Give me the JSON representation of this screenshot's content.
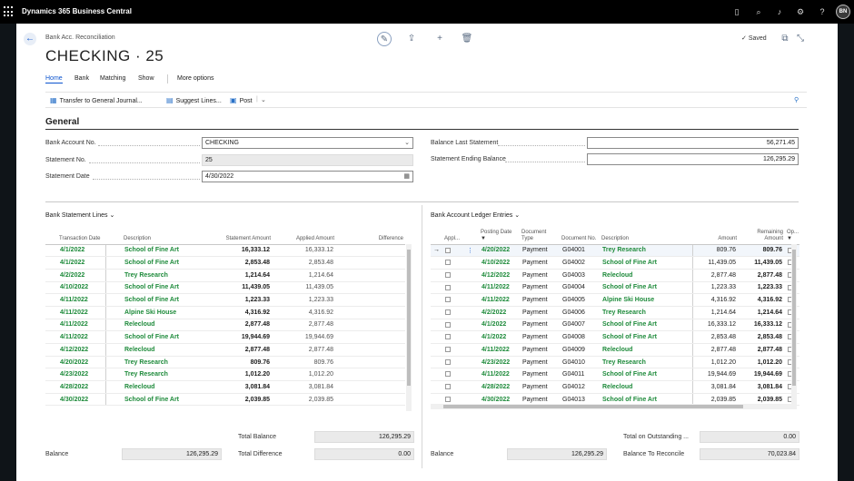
{
  "app": {
    "title": "Dynamics 365 Business Central",
    "avatar": "BN"
  },
  "header": {
    "breadcrumb": "Bank Acc. Reconciliation",
    "title": "CHECKING · 25",
    "saved": "Saved"
  },
  "menu": {
    "home": "Home",
    "bank": "Bank",
    "matching": "Matching",
    "show": "Show",
    "more": "More options"
  },
  "actions": {
    "transfer": "Transfer to General Journal...",
    "suggest": "Suggest Lines...",
    "post": "Post"
  },
  "general": {
    "title": "General",
    "bank_account_no_label": "Bank Account No.",
    "bank_account_no": "CHECKING",
    "statement_no_label": "Statement No.",
    "statement_no": "25",
    "statement_date_label": "Statement Date",
    "statement_date": "4/30/2022",
    "balance_last_label": "Balance Last Statement",
    "balance_last": "56,271.45",
    "ending_balance_label": "Statement Ending Balance",
    "ending_balance": "126,295.29"
  },
  "statement_lines": {
    "title": "Bank Statement Lines",
    "columns": [
      "Transaction Date",
      "Description",
      "Statement Amount",
      "Applied Amount",
      "Difference"
    ],
    "rows": [
      [
        "4/1/2022",
        "School of Fine Art",
        "16,333.12",
        "16,333.12",
        ""
      ],
      [
        "4/1/2022",
        "School of Fine Art",
        "2,853.48",
        "2,853.48",
        ""
      ],
      [
        "4/2/2022",
        "Trey Research",
        "1,214.64",
        "1,214.64",
        ""
      ],
      [
        "4/10/2022",
        "School of Fine Art",
        "11,439.05",
        "11,439.05",
        ""
      ],
      [
        "4/11/2022",
        "School of Fine Art",
        "1,223.33",
        "1,223.33",
        ""
      ],
      [
        "4/11/2022",
        "Alpine Ski House",
        "4,316.92",
        "4,316.92",
        ""
      ],
      [
        "4/11/2022",
        "Relecloud",
        "2,877.48",
        "2,877.48",
        ""
      ],
      [
        "4/11/2022",
        "School of Fine Art",
        "19,944.69",
        "19,944.69",
        ""
      ],
      [
        "4/12/2022",
        "Relecloud",
        "2,877.48",
        "2,877.48",
        ""
      ],
      [
        "4/20/2022",
        "Trey Research",
        "809.76",
        "809.76",
        ""
      ],
      [
        "4/23/2022",
        "Trey Research",
        "1,012.20",
        "1,012.20",
        ""
      ],
      [
        "4/28/2022",
        "Relecloud",
        "3,081.84",
        "3,081.84",
        ""
      ],
      [
        "4/30/2022",
        "School of Fine Art",
        "2,039.85",
        "2,039.85",
        ""
      ]
    ],
    "total_balance_label": "Total Balance",
    "total_balance": "126,295.29",
    "total_difference_label": "Total Difference",
    "total_difference": "0.00",
    "balance_label": "Balance",
    "balance": "126,295.29"
  },
  "ledger_entries": {
    "title": "Bank Account Ledger Entries",
    "columns": [
      "Appl...",
      "Posting Date",
      "Document Type",
      "Document No.",
      "Description",
      "Amount",
      "Remaining Amount",
      "Op..."
    ],
    "rows": [
      [
        "4/20/2022",
        "Payment",
        "G04001",
        "Trey Research",
        "809.76",
        "809.76"
      ],
      [
        "4/10/2022",
        "Payment",
        "G04002",
        "School of Fine Art",
        "11,439.05",
        "11,439.05"
      ],
      [
        "4/12/2022",
        "Payment",
        "G04003",
        "Relecloud",
        "2,877.48",
        "2,877.48"
      ],
      [
        "4/11/2022",
        "Payment",
        "G04004",
        "School of Fine Art",
        "1,223.33",
        "1,223.33"
      ],
      [
        "4/11/2022",
        "Payment",
        "G04005",
        "Alpine Ski House",
        "4,316.92",
        "4,316.92"
      ],
      [
        "4/2/2022",
        "Payment",
        "G04006",
        "Trey Research",
        "1,214.64",
        "1,214.64"
      ],
      [
        "4/1/2022",
        "Payment",
        "G04007",
        "School of Fine Art",
        "16,333.12",
        "16,333.12"
      ],
      [
        "4/1/2022",
        "Payment",
        "G04008",
        "School of Fine Art",
        "2,853.48",
        "2,853.48"
      ],
      [
        "4/11/2022",
        "Payment",
        "G04009",
        "Relecloud",
        "2,877.48",
        "2,877.48"
      ],
      [
        "4/23/2022",
        "Payment",
        "G04010",
        "Trey Research",
        "1,012.20",
        "1,012.20"
      ],
      [
        "4/11/2022",
        "Payment",
        "G04011",
        "School of Fine Art",
        "19,944.69",
        "19,944.69"
      ],
      [
        "4/28/2022",
        "Payment",
        "G04012",
        "Relecloud",
        "3,081.84",
        "3,081.84"
      ],
      [
        "4/30/2022",
        "Payment",
        "G04013",
        "School of Fine Art",
        "2,039.85",
        "2,039.85"
      ]
    ],
    "outstanding_label": "Total on Outstanding ...",
    "outstanding": "0.00",
    "balance_label": "Balance",
    "balance": "126,295.29",
    "to_reconcile_label": "Balance To Reconcile",
    "to_reconcile": "70,023.84"
  },
  "colors": {
    "accent": "#0b53ce",
    "link_green": "#1d8a3a",
    "topbar": "#000000"
  }
}
